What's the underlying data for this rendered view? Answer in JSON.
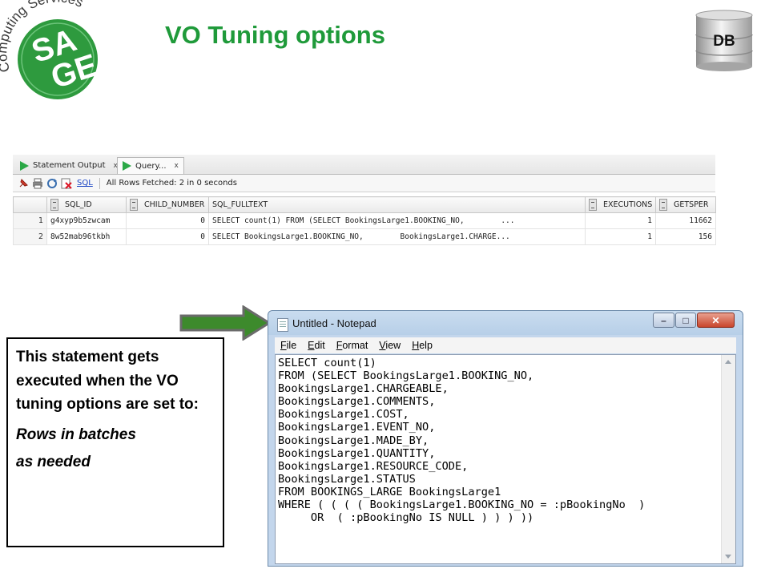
{
  "logo": {
    "arc_text": "Computing Services",
    "word": "SAGE"
  },
  "slide": {
    "title": "VO Tuning options",
    "db_label": "DB"
  },
  "sqldev": {
    "tabs": [
      {
        "label": "Statement Output",
        "close": "x"
      },
      {
        "label": "Query...",
        "close": "x"
      }
    ],
    "toolbar": {
      "sql_link": "SQL",
      "status": "All Rows Fetched: 2 in 0 seconds"
    },
    "columns": [
      "SQL_ID",
      "CHILD_NUMBER",
      "SQL_FULLTEXT",
      "EXECUTIONS",
      "GETSPER"
    ],
    "rows": [
      {
        "n": "1",
        "sql_id": "g4xyp9b5zwcam",
        "child": "0",
        "text": "SELECT count(1) FROM (SELECT BookingsLarge1.BOOKING_NO,        ...",
        "exec": "1",
        "gets": "11662"
      },
      {
        "n": "2",
        "sql_id": "8w52mab96tkbh",
        "child": "0",
        "text": "SELECT BookingsLarge1.BOOKING_NO,        BookingsLarge1.CHARGE...",
        "exec": "1",
        "gets": "156"
      }
    ]
  },
  "callout": {
    "text": "This statement gets executed  when the VO tuning options are set to:",
    "option1": "Rows in batches",
    "option2": "as needed"
  },
  "notepad": {
    "title": "Untitled - Notepad",
    "menus": [
      "File",
      "Edit",
      "Format",
      "View",
      "Help"
    ],
    "content": "SELECT count(1)\nFROM (SELECT BookingsLarge1.BOOKING_NO,\nBookingsLarge1.CHARGEABLE,\nBookingsLarge1.COMMENTS,\nBookingsLarge1.COST,\nBookingsLarge1.EVENT_NO,\nBookingsLarge1.MADE_BY,\nBookingsLarge1.QUANTITY,\nBookingsLarge1.RESOURCE_CODE,\nBookingsLarge1.STATUS\nFROM BOOKINGS_LARGE BookingsLarge1\nWHERE ( ( ( ( BookingsLarge1.BOOKING_NO = :pBookingNo  )\n     OR  ( :pBookingNo IS NULL ) ) ) ))"
  },
  "colors": {
    "title_green": "#1f9a3a",
    "logo_green": "#2e9a3e",
    "arrow_green": "#3d8a2c"
  }
}
